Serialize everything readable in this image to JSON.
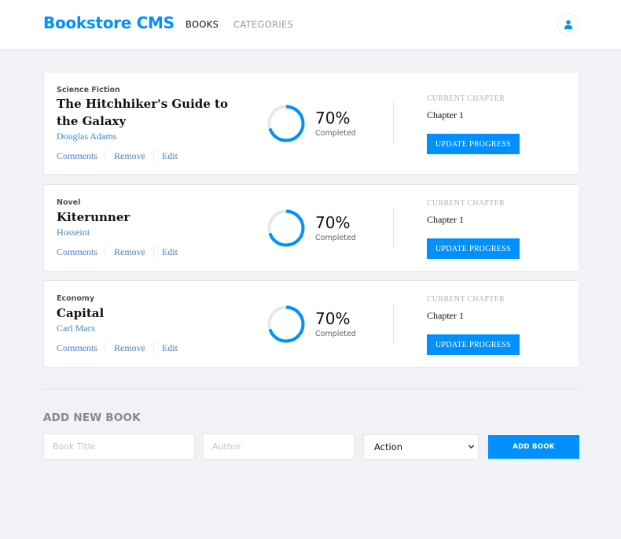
{
  "header": {
    "logo": "Bookstore CMS",
    "nav": [
      "BOOKS",
      "CATEGORIES"
    ],
    "user_icon": "user-icon"
  },
  "books": [
    {
      "category": "Science Fiction",
      "title": "The Hitchhiker's Guide to the Galaxy",
      "author": "Douglas Adams",
      "actions": [
        "Comments",
        "Remove",
        "Edit"
      ],
      "progress_percent": 70,
      "percent_label": "70%",
      "completed_label": "Completed",
      "current_chapter_label": "CURRENT CHAPTER",
      "chapter": "Chapter 1",
      "update_label": "UPDATE PROGRESS"
    },
    {
      "category": "Novel",
      "title": "Kiterunner",
      "author": "Hosseini",
      "actions": [
        "Comments",
        "Remove",
        "Edit"
      ],
      "progress_percent": 70,
      "percent_label": "70%",
      "completed_label": "Completed",
      "current_chapter_label": "CURRENT CHAPTER",
      "chapter": "Chapter 1",
      "update_label": "UPDATE PROGRESS"
    },
    {
      "category": "Economy",
      "title": "Capital",
      "author": "Carl Marx",
      "actions": [
        "Comments",
        "Remove",
        "Edit"
      ],
      "progress_percent": 70,
      "percent_label": "70%",
      "completed_label": "Completed",
      "current_chapter_label": "CURRENT CHAPTER",
      "chapter": "Chapter 1",
      "update_label": "UPDATE PROGRESS"
    }
  ],
  "form": {
    "title": "ADD NEW BOOK",
    "title_placeholder": "Book Title",
    "author_placeholder": "Author",
    "select_value": "Action",
    "submit_label": "ADD BOOK"
  },
  "colors": {
    "accent": "#0290ff",
    "link": "#4386bf",
    "ring_track": "#e8e8e8",
    "background": "#f1f2f5"
  }
}
